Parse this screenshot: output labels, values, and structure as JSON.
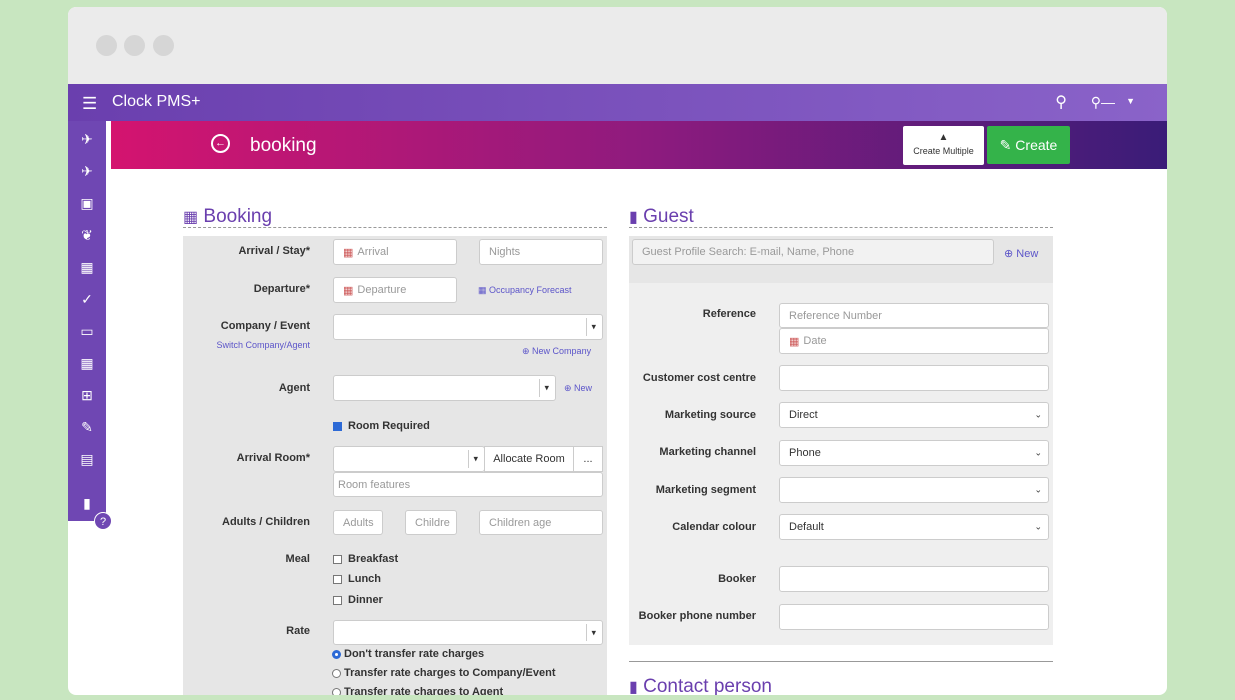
{
  "app": {
    "title": "Clock PMS+"
  },
  "page": {
    "title": "booking",
    "create_multiple_label": "Create Multiple",
    "create_label": "Create"
  },
  "booking": {
    "title": "Booking",
    "arrival_stay_label": "Arrival / Stay*",
    "arrival_placeholder": "Arrival",
    "nights_placeholder": "Nights",
    "departure_label": "Departure*",
    "departure_placeholder": "Departure",
    "occupancy_forecast": "Occupancy Forecast",
    "company_event_label": "Company / Event",
    "switch_company_agent": "Switch Company/Agent",
    "new_company": "New Company",
    "agent_label": "Agent",
    "agent_new": "New",
    "room_required_label": "Room Required",
    "room_required_checked": true,
    "arrival_room_label": "Arrival Room*",
    "allocate_room": "Allocate Room",
    "more_button": "...",
    "room_features_placeholder": "Room features",
    "adults_children_label": "Adults / Children",
    "adults_placeholder": "Adults",
    "children_placeholder": "Childrе",
    "children_age_placeholder": "Children age",
    "meal_label": "Meal",
    "meals": [
      {
        "label": "Breakfast",
        "checked": false
      },
      {
        "label": "Lunch",
        "checked": false
      },
      {
        "label": "Dinner",
        "checked": false
      }
    ],
    "rate_label": "Rate",
    "rate_options": [
      {
        "label": "Don't transfer rate charges",
        "selected": true
      },
      {
        "label": "Transfer rate charges to Company/Event",
        "selected": false
      },
      {
        "label": "Transfer rate charges to Agent",
        "selected": false
      }
    ]
  },
  "guest": {
    "title": "Guest",
    "search_placeholder": "Guest Profile Search: E-mail, Name, Phone",
    "new_label": "New",
    "reference_label": "Reference",
    "reference_placeholder": "Reference Number",
    "date_placeholder": "Date",
    "cost_centre_label": "Customer cost centre",
    "marketing_source_label": "Marketing source",
    "marketing_source_value": "Direct",
    "marketing_channel_label": "Marketing channel",
    "marketing_channel_value": "Phone",
    "marketing_segment_label": "Marketing segment",
    "marketing_segment_value": "",
    "calendar_colour_label": "Calendar colour",
    "calendar_colour_value": "Default",
    "booker_label": "Booker",
    "booker_phone_label": "Booker phone number"
  },
  "contact": {
    "title": "Contact person"
  },
  "icons": [
    "menu-icon",
    "search-icon",
    "key-icon",
    "caret-down-icon",
    "departure-icon",
    "arrival-icon",
    "bed-icon",
    "leaf-icon",
    "calendar-icon",
    "check-icon",
    "monitor-icon",
    "calendar-icon",
    "grid-icon",
    "pencil-icon",
    "document-icon",
    "book-icon",
    "help-icon"
  ],
  "colors": {
    "topbar": "#7b52bd",
    "header_start": "#d4146f",
    "header_end": "#3a1c78",
    "create": "#34b34a",
    "accent": "#6a3fae"
  }
}
